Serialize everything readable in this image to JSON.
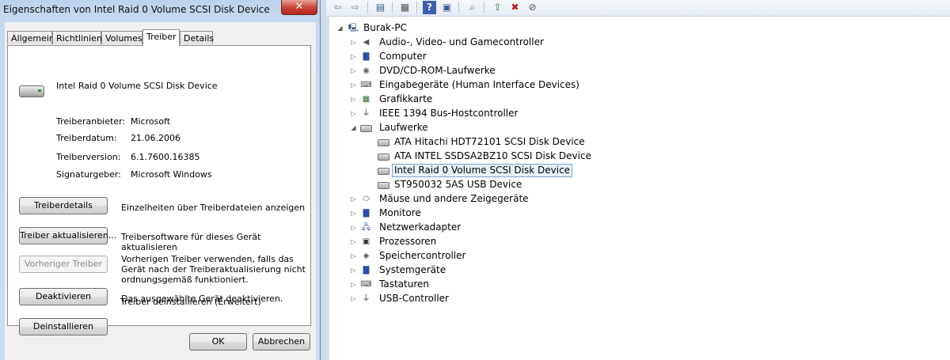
{
  "dialog": {
    "title": "Eigenschaften von Intel Raid 0 Volume SCSI Disk Device",
    "close_label": "✕",
    "tabs": [
      {
        "label": "Allgemein"
      },
      {
        "label": "Richtlinien"
      },
      {
        "label": "Volumes"
      },
      {
        "label": "Treiber"
      },
      {
        "label": "Details"
      }
    ],
    "active_tab": "Treiber",
    "device_name": "Intel Raid 0 Volume SCSI Disk Device",
    "properties": [
      {
        "label": "Treiberanbieter:",
        "value": "Microsoft"
      },
      {
        "label": "Treiberdatum:",
        "value": "21.06.2006"
      },
      {
        "label": "Treiberversion:",
        "value": "6.1.7600.16385"
      },
      {
        "label": "Signaturgeber:",
        "value": "Microsoft Windows"
      }
    ],
    "actions": [
      {
        "button": "Treiberdetails",
        "desc": "Einzelheiten über Treiberdateien anzeigen",
        "enabled": true
      },
      {
        "button": "Treiber aktualisieren...",
        "desc": "Treibersoftware für dieses Gerät aktualisieren",
        "enabled": true
      },
      {
        "button": "Vorheriger Treiber",
        "desc": "Vorherigen Treiber verwenden, falls das Gerät nach der Treiberaktualisierung nicht ordnungsgemäß funktioniert.",
        "enabled": false
      },
      {
        "button": "Deaktivieren",
        "desc": "Das ausgewählte Gerät deaktivieren.",
        "enabled": true
      },
      {
        "button": "Deinstallieren",
        "desc": "Treiber deinstallieren (Erweitert)",
        "enabled": true
      }
    ],
    "ok_label": "OK",
    "cancel_label": "Abbrechen"
  },
  "device_manager": {
    "toolbar": [
      {
        "icon": "back-arrow-icon"
      },
      {
        "icon": "forward-arrow-icon"
      },
      {
        "icon": "show-hide-tree-icon"
      },
      {
        "icon": "properties-icon"
      },
      {
        "icon": "help-icon"
      },
      {
        "icon": "action-pane-icon"
      },
      {
        "icon": "scan-hardware-icon"
      },
      {
        "icon": "update-driver-icon"
      },
      {
        "icon": "uninstall-icon"
      },
      {
        "icon": "disable-icon"
      }
    ],
    "root": "Burak-PC",
    "categories": [
      {
        "label": "Audio-, Video- und Gamecontroller",
        "icon": "speaker-icon",
        "expanded": false
      },
      {
        "label": "Computer",
        "icon": "computer-icon",
        "expanded": false
      },
      {
        "label": "DVD/CD-ROM-Laufwerke",
        "icon": "optical-drive-icon",
        "expanded": false
      },
      {
        "label": "Eingabegeräte (Human Interface Devices)",
        "icon": "hid-icon",
        "expanded": false
      },
      {
        "label": "Grafikkarte",
        "icon": "display-adapter-icon",
        "expanded": false
      },
      {
        "label": "IEEE 1394 Bus-Hostcontroller",
        "icon": "firewire-icon",
        "expanded": false
      },
      {
        "label": "Laufwerke",
        "icon": "disk-drive-icon",
        "expanded": true,
        "children": [
          {
            "label": "ATA Hitachi HDT72101 SCSI Disk Device"
          },
          {
            "label": "ATA INTEL SSDSA2BZ10 SCSI Disk Device"
          },
          {
            "label": "Intel Raid 0 Volume SCSI Disk Device",
            "selected": true
          },
          {
            "label": "ST950032 5AS USB Device"
          }
        ]
      },
      {
        "label": "Mäuse und andere Zeigegeräte",
        "icon": "mouse-icon",
        "expanded": false
      },
      {
        "label": "Monitore",
        "icon": "monitor-icon",
        "expanded": false
      },
      {
        "label": "Netzwerkadapter",
        "icon": "network-adapter-icon",
        "expanded": false
      },
      {
        "label": "Prozessoren",
        "icon": "processor-icon",
        "expanded": false
      },
      {
        "label": "Speichercontroller",
        "icon": "storage-controller-icon",
        "expanded": false
      },
      {
        "label": "Systemgeräte",
        "icon": "system-devices-icon",
        "expanded": false
      },
      {
        "label": "Tastaturen",
        "icon": "keyboard-icon",
        "expanded": false
      },
      {
        "label": "USB-Controller",
        "icon": "usb-icon",
        "expanded": false
      }
    ]
  }
}
